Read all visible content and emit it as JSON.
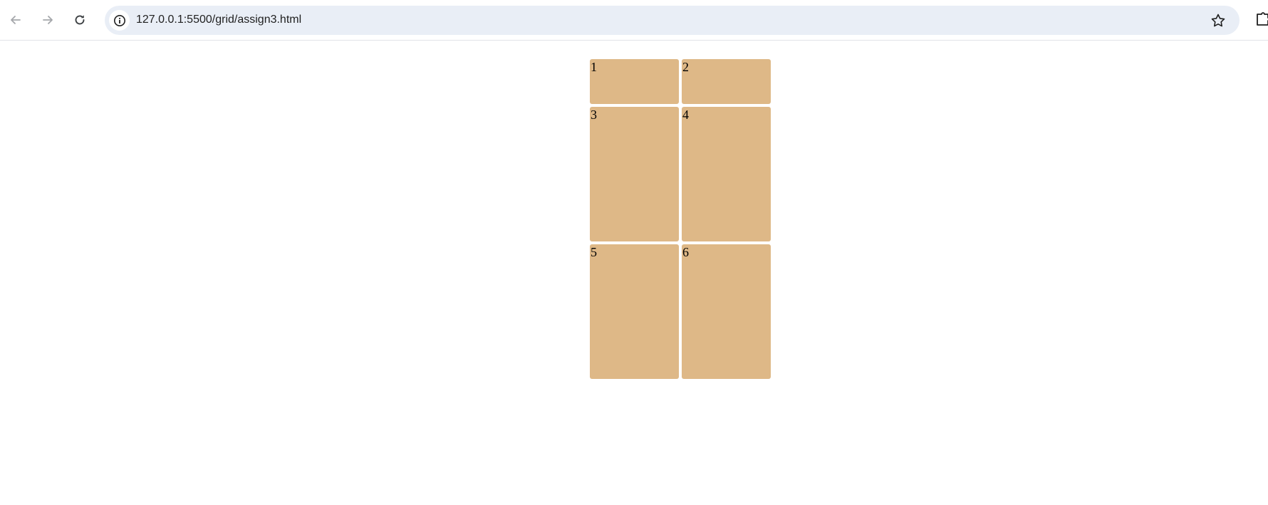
{
  "browser": {
    "url": "127.0.0.1:5500/grid/assign3.html",
    "icons": {
      "back": "arrow-left-icon",
      "forward": "arrow-right-icon",
      "reload": "reload-icon",
      "site_info": "info-icon",
      "bookmark": "star-icon",
      "extensions": "puzzle-icon"
    }
  },
  "page": {
    "cell_color": "#deb887",
    "cells": [
      "1",
      "2",
      "3",
      "4",
      "5",
      "6"
    ]
  }
}
